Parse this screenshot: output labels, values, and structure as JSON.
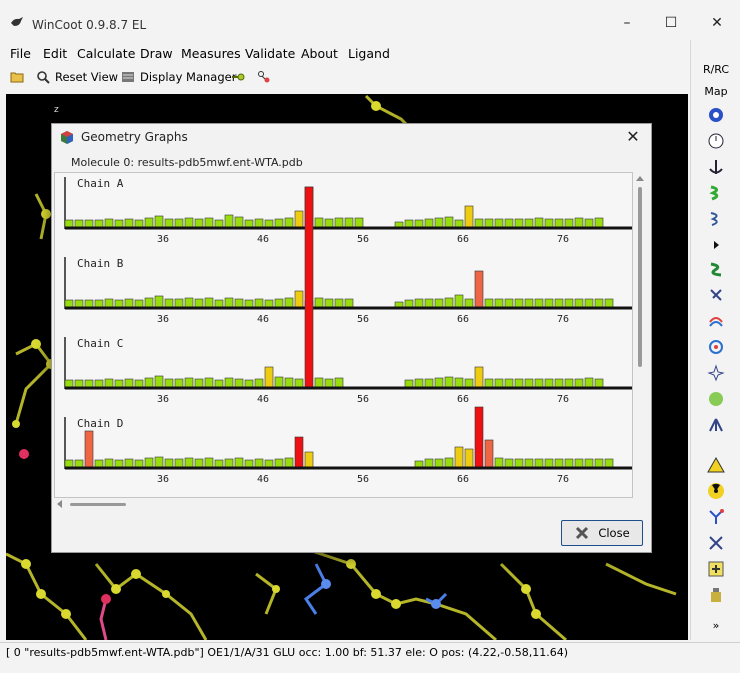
{
  "window": {
    "title": "WinCoot 0.9.8.7 EL"
  },
  "menu": [
    "File",
    "Edit",
    "Calculate",
    "Draw",
    "Measures",
    "Validate",
    "About",
    "Ligand"
  ],
  "toolbar": {
    "reset_view": "Reset View",
    "display_manager": "Display Manager"
  },
  "viewer": {
    "axis_label": "z"
  },
  "right_toolbar": {
    "rrc": "R/RC",
    "map": "Map",
    "more": "»"
  },
  "dialog": {
    "title": "Geometry Graphs",
    "molecule": "Molecule 0: results-pdb5mwf.ent-WTA.pdb",
    "close_label": "Close",
    "chains": [
      {
        "name": "Chain A",
        "ticks": [
          "36",
          "46",
          "56",
          "66",
          "76"
        ]
      },
      {
        "name": "Chain B",
        "ticks": [
          "36",
          "46",
          "56",
          "66",
          "76"
        ]
      },
      {
        "name": "Chain C",
        "ticks": [
          "36",
          "46",
          "56",
          "66",
          "76"
        ]
      },
      {
        "name": "Chain D",
        "ticks": [
          "36",
          "46",
          "56",
          "66",
          "76"
        ]
      }
    ]
  },
  "colors": {
    "good": "#99dd11",
    "warn": "#eecc11",
    "bad": "#ee6644",
    "outlier": "#ee1111"
  },
  "status": "[ 0 \"results-pdb5mwf.ent-WTA.pdb\"]  OE1/1/A/31 GLU occ: 1.00 bf: 51.37 ele:  O pos: (4.22,-0.58,11.64)"
}
